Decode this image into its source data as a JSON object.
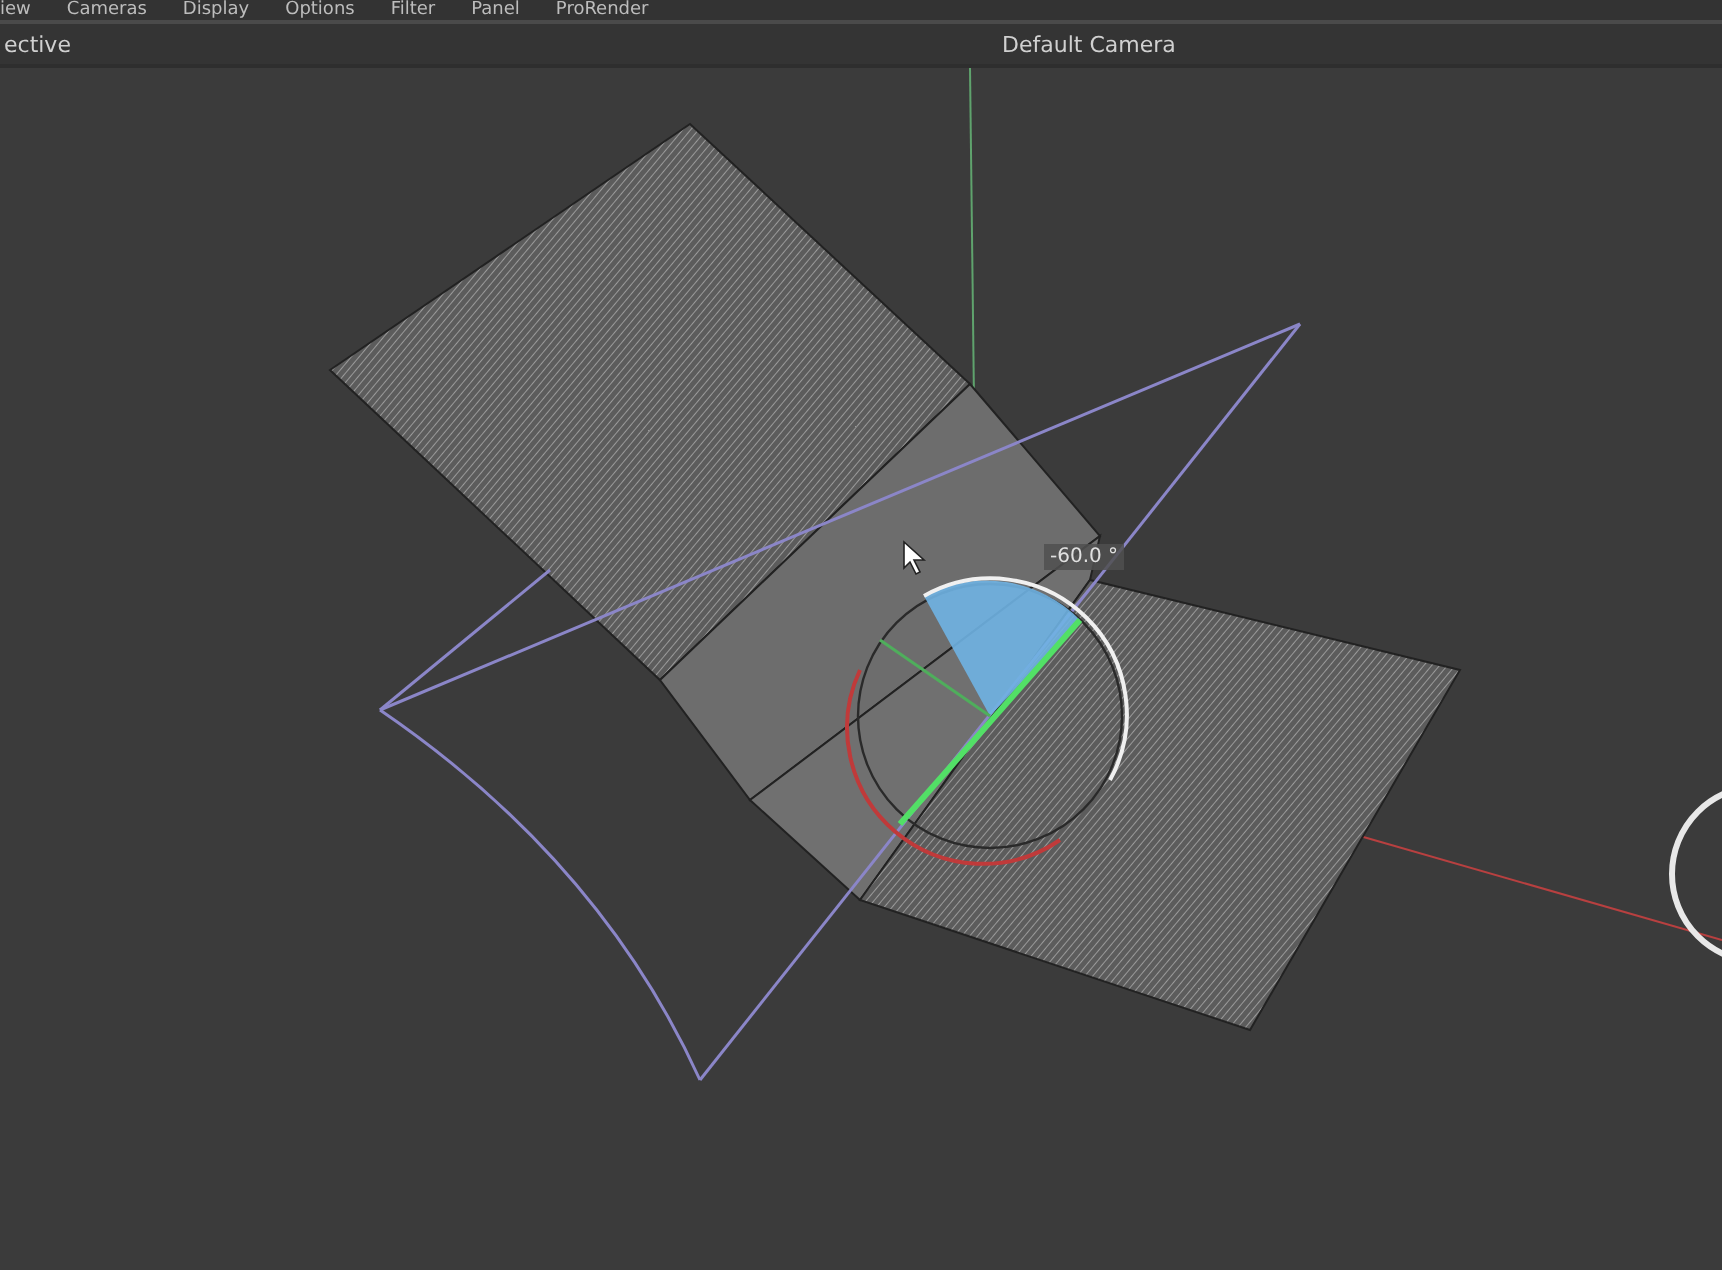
{
  "menu_bar": {
    "items": [
      "iew",
      "Cameras",
      "Display",
      "Options",
      "Filter",
      "Panel",
      "ProRender"
    ]
  },
  "viewport_header": {
    "view_name": "ective",
    "camera": "Default Camera"
  },
  "viewport": {
    "angle_readout": "-60.0 °"
  }
}
